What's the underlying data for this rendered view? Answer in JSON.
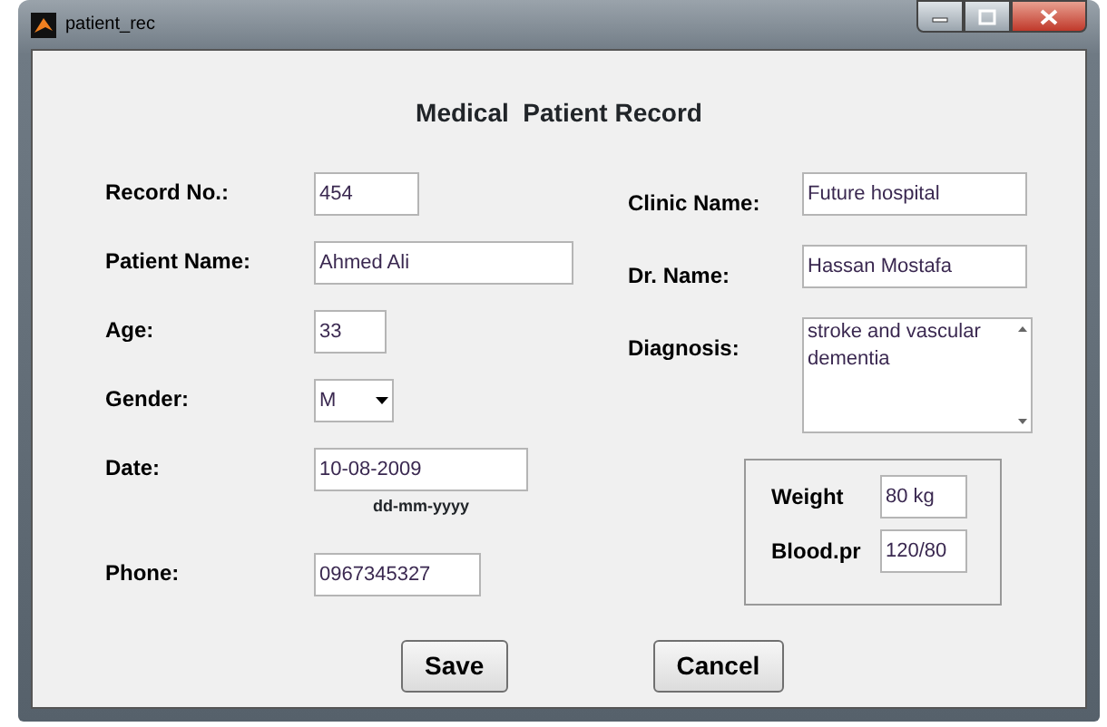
{
  "window": {
    "title": "patient_rec"
  },
  "heading": "Medical  Patient Record",
  "left_fields": [
    {
      "kind": "text",
      "label": "Record No.:",
      "value": "454"
    },
    {
      "kind": "text",
      "label": "Patient Name:",
      "value": "Ahmed Ali"
    },
    {
      "kind": "text",
      "label": "Age:",
      "value": "33"
    },
    {
      "kind": "select",
      "label": "Gender:",
      "value": "M"
    },
    {
      "kind": "text",
      "label": "Date:",
      "value": "10-08-2009",
      "hint": "dd-mm-yyyy"
    },
    {
      "kind": "text",
      "label": "Phone:",
      "value": "0967345327"
    }
  ],
  "right_fields": [
    {
      "kind": "text",
      "label": "Clinic Name:",
      "value": "Future hospital"
    },
    {
      "kind": "text",
      "label": "Dr. Name:",
      "value": "Hassan Mostafa"
    },
    {
      "kind": "textarea",
      "label": "Diagnosis:",
      "value": "stroke and vascular dementia"
    }
  ],
  "vitals": [
    {
      "label": "Weight",
      "value": "80 kg"
    },
    {
      "label": "Blood.pr",
      "value": "120/80"
    }
  ],
  "buttons": [
    "Save",
    "Cancel"
  ]
}
